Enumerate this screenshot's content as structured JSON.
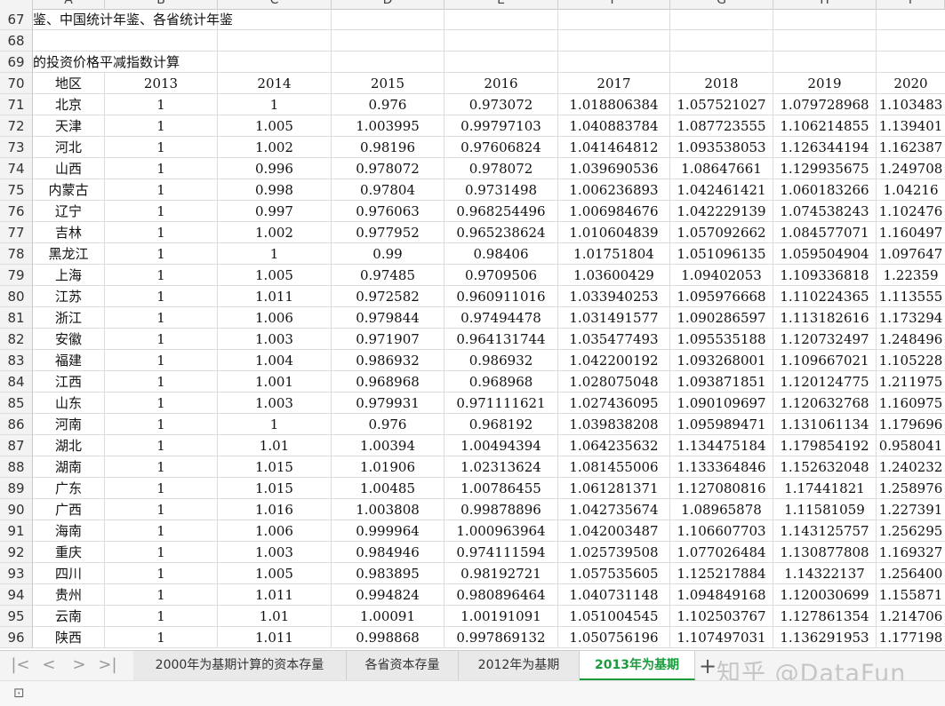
{
  "sheet": {
    "column_letters": [
      "A",
      "B",
      "C",
      "D",
      "E",
      "F",
      "G",
      "H",
      "I"
    ],
    "rows": [
      {
        "n": "67",
        "title": "鉴、中国统计年鉴、各省统计年鉴"
      },
      {
        "n": "68",
        "title": ""
      },
      {
        "n": "69",
        "title": "的投资价格平减指数计算"
      },
      {
        "n": "70",
        "cells": [
          "地区",
          "2013",
          "2014",
          "2015",
          "2016",
          "2017",
          "2018",
          "2019",
          "2020"
        ]
      },
      {
        "n": "71",
        "cells": [
          "北京",
          "1",
          "1",
          "0.976",
          "0.973072",
          "1.018806384",
          "1.057521027",
          "1.079728968",
          "1.103483"
        ]
      },
      {
        "n": "72",
        "cells": [
          "天津",
          "1",
          "1.005",
          "1.003995",
          "0.99797103",
          "1.040883784",
          "1.087723555",
          "1.106214855",
          "1.139401"
        ]
      },
      {
        "n": "73",
        "cells": [
          "河北",
          "1",
          "1.002",
          "0.98196",
          "0.97606824",
          "1.041464812",
          "1.093538053",
          "1.126344194",
          "1.162387"
        ]
      },
      {
        "n": "74",
        "cells": [
          "山西",
          "1",
          "0.996",
          "0.978072",
          "0.978072",
          "1.039690536",
          "1.08647661",
          "1.129935675",
          "1.249708"
        ]
      },
      {
        "n": "75",
        "cells": [
          "内蒙古",
          "1",
          "0.998",
          "0.97804",
          "0.9731498",
          "1.006236893",
          "1.042461421",
          "1.060183266",
          "1.04216"
        ]
      },
      {
        "n": "76",
        "cells": [
          "辽宁",
          "1",
          "0.997",
          "0.976063",
          "0.968254496",
          "1.006984676",
          "1.042229139",
          "1.074538243",
          "1.102476"
        ]
      },
      {
        "n": "77",
        "cells": [
          "吉林",
          "1",
          "1.002",
          "0.977952",
          "0.965238624",
          "1.010604839",
          "1.057092662",
          "1.084577071",
          "1.160497"
        ]
      },
      {
        "n": "78",
        "cells": [
          "黑龙江",
          "1",
          "1",
          "0.99",
          "0.98406",
          "1.01751804",
          "1.051096135",
          "1.059504904",
          "1.097647"
        ]
      },
      {
        "n": "79",
        "cells": [
          "上海",
          "1",
          "1.005",
          "0.97485",
          "0.9709506",
          "1.03600429",
          "1.09402053",
          "1.109336818",
          "1.22359"
        ]
      },
      {
        "n": "80",
        "cells": [
          "江苏",
          "1",
          "1.011",
          "0.972582",
          "0.960911016",
          "1.033940253",
          "1.095976668",
          "1.110224365",
          "1.113555"
        ]
      },
      {
        "n": "81",
        "cells": [
          "浙江",
          "1",
          "1.006",
          "0.979844",
          "0.97494478",
          "1.031491577",
          "1.090286597",
          "1.113182616",
          "1.173294"
        ]
      },
      {
        "n": "82",
        "cells": [
          "安徽",
          "1",
          "1.003",
          "0.971907",
          "0.964131744",
          "1.035477493",
          "1.095535188",
          "1.120732497",
          "1.248496"
        ]
      },
      {
        "n": "83",
        "cells": [
          "福建",
          "1",
          "1.004",
          "0.986932",
          "0.986932",
          "1.042200192",
          "1.093268001",
          "1.109667021",
          "1.105228"
        ]
      },
      {
        "n": "84",
        "cells": [
          "江西",
          "1",
          "1.001",
          "0.968968",
          "0.968968",
          "1.028075048",
          "1.093871851",
          "1.120124775",
          "1.211975"
        ]
      },
      {
        "n": "85",
        "cells": [
          "山东",
          "1",
          "1.003",
          "0.979931",
          "0.971111621",
          "1.027436095",
          "1.090109697",
          "1.120632768",
          "1.160975"
        ]
      },
      {
        "n": "86",
        "cells": [
          "河南",
          "1",
          "1",
          "0.976",
          "0.968192",
          "1.039838208",
          "1.095989471",
          "1.131061134",
          "1.179696"
        ]
      },
      {
        "n": "87",
        "cells": [
          "湖北",
          "1",
          "1.01",
          "1.00394",
          "1.00494394",
          "1.064235632",
          "1.134475184",
          "1.179854192",
          "0.958041"
        ]
      },
      {
        "n": "88",
        "cells": [
          "湖南",
          "1",
          "1.015",
          "1.01906",
          "1.02313624",
          "1.081455006",
          "1.133364846",
          "1.152632048",
          "1.240232"
        ]
      },
      {
        "n": "89",
        "cells": [
          "广东",
          "1",
          "1.015",
          "1.00485",
          "1.00786455",
          "1.061281371",
          "1.127080816",
          "1.17441821",
          "1.258976"
        ]
      },
      {
        "n": "90",
        "cells": [
          "广西",
          "1",
          "1.016",
          "1.003808",
          "0.99878896",
          "1.042735674",
          "1.08965878",
          "1.11581059",
          "1.227391"
        ]
      },
      {
        "n": "91",
        "cells": [
          "海南",
          "1",
          "1.006",
          "0.999964",
          "1.000963964",
          "1.042003487",
          "1.106607703",
          "1.143125757",
          "1.256295"
        ]
      },
      {
        "n": "92",
        "cells": [
          "重庆",
          "1",
          "1.003",
          "0.984946",
          "0.974111594",
          "1.025739508",
          "1.077026484",
          "1.130877808",
          "1.169327"
        ]
      },
      {
        "n": "93",
        "cells": [
          "四川",
          "1",
          "1.005",
          "0.983895",
          "0.98192721",
          "1.057535605",
          "1.125217884",
          "1.14322137",
          "1.256400"
        ]
      },
      {
        "n": "94",
        "cells": [
          "贵州",
          "1",
          "1.011",
          "0.994824",
          "0.980896464",
          "1.040731148",
          "1.094849168",
          "1.120030699",
          "1.155871"
        ]
      },
      {
        "n": "95",
        "cells": [
          "云南",
          "1",
          "1.01",
          "1.00091",
          "1.00191091",
          "1.051004545",
          "1.102503767",
          "1.127861354",
          "1.214706"
        ]
      },
      {
        "n": "96",
        "cells": [
          "陕西",
          "1",
          "1.011",
          "0.998868",
          "0.997869132",
          "1.050756196",
          "1.107497031",
          "1.136291953",
          "1.177198"
        ]
      }
    ]
  },
  "tabs": [
    {
      "label": "2000年为基期计算的资本存量"
    },
    {
      "label": "各省资本存量"
    },
    {
      "label": "2012年为基期"
    },
    {
      "label": "2013年为基期"
    }
  ],
  "active_tab_index": 3,
  "nav_icons": [
    "first-sheet-icon",
    "prev-sheet-icon",
    "next-sheet-icon",
    "last-sheet-icon"
  ],
  "add_tab_label": "+",
  "watermark": "知乎 @DataFun",
  "colors": {
    "active_tab": "#1a9c3c",
    "grid": "#dcdcdc",
    "header_bg": "#f3f3f3"
  }
}
